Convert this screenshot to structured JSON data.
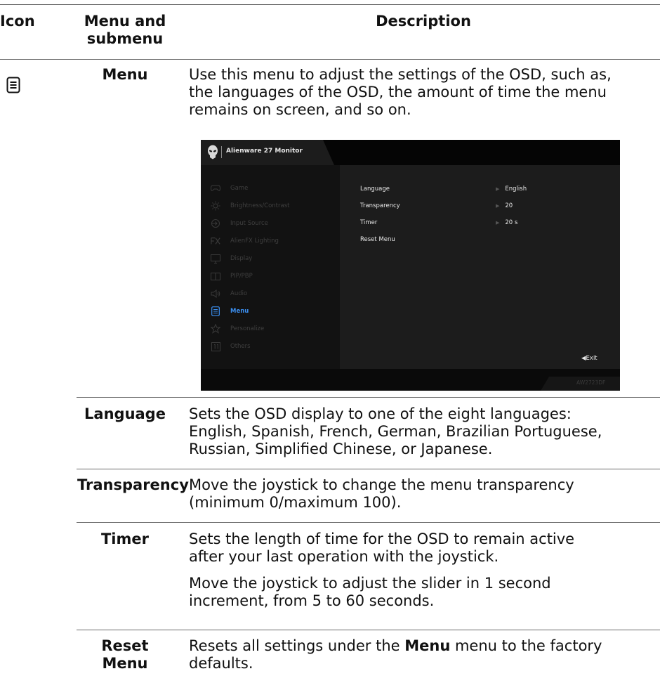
{
  "headers": {
    "icon": "Icon",
    "menu_line1": "Menu and",
    "menu_line2": "submenu",
    "description": "Description"
  },
  "menu_row": {
    "icon": "menu-list-icon",
    "name": "Menu",
    "description": "Use this menu to adjust the settings of the OSD, such as, the languages of the OSD, the amount of time the menu remains on screen, and so on.",
    "desc_lines": [
      "Use this menu to adjust the settings of the OSD, such as,",
      "the languages of the OSD, the amount of time the menu",
      "remains on screen, and so on."
    ]
  },
  "osd": {
    "monitor_title": "Alienware 27 Monitor",
    "nav_items": [
      {
        "label": "Game",
        "icon": "gamepad-icon",
        "active": false
      },
      {
        "label": "Brightness/Contrast",
        "icon": "brightness-icon",
        "active": false
      },
      {
        "label": "Input Source",
        "icon": "input-source-icon",
        "active": false
      },
      {
        "label": "AlienFX Lighting",
        "icon": "fx-icon",
        "active": false
      },
      {
        "label": "Display",
        "icon": "monitor-icon",
        "active": false
      },
      {
        "label": "PIP/PBP",
        "icon": "pip-icon",
        "active": false
      },
      {
        "label": "Audio",
        "icon": "speaker-icon",
        "active": false
      },
      {
        "label": "Menu",
        "icon": "menu-list-icon",
        "active": true
      },
      {
        "label": "Personalize",
        "icon": "star-icon",
        "active": false
      },
      {
        "label": "Others",
        "icon": "others-icon",
        "active": false
      }
    ],
    "settings": [
      {
        "label": "Language",
        "value": "English"
      },
      {
        "label": "Transparency",
        "value": "20"
      },
      {
        "label": "Timer",
        "value": "20 s"
      },
      {
        "label": "Reset Menu",
        "value": ""
      }
    ],
    "exit_label": "◀Exit",
    "model": "AW2723DF",
    "active_color": "#3b8ff0"
  },
  "rows": [
    {
      "name": "Language",
      "desc_lines": [
        "Sets the OSD display to one of the eight languages:",
        "English, Spanish, French, German, Brazilian Portuguese,",
        "Russian, Simplified Chinese, or Japanese."
      ]
    },
    {
      "name": "Transparency",
      "desc_lines": [
        "Move the joystick to change the menu transparency",
        "(minimum 0/maximum 100)."
      ]
    },
    {
      "name": "Timer",
      "desc_lines": [
        "Sets the length of time for the OSD to remain active",
        "after your last operation with the joystick."
      ],
      "desc2_lines": [
        "Move the joystick to adjust the slider in 1 second",
        "increment, from 5 to 60 seconds."
      ]
    },
    {
      "name": "Reset Menu",
      "desc_pre": "Resets all settings under the ",
      "desc_bold": "Menu",
      "desc_post": " menu to the factory",
      "desc_line2": "defaults."
    }
  ]
}
